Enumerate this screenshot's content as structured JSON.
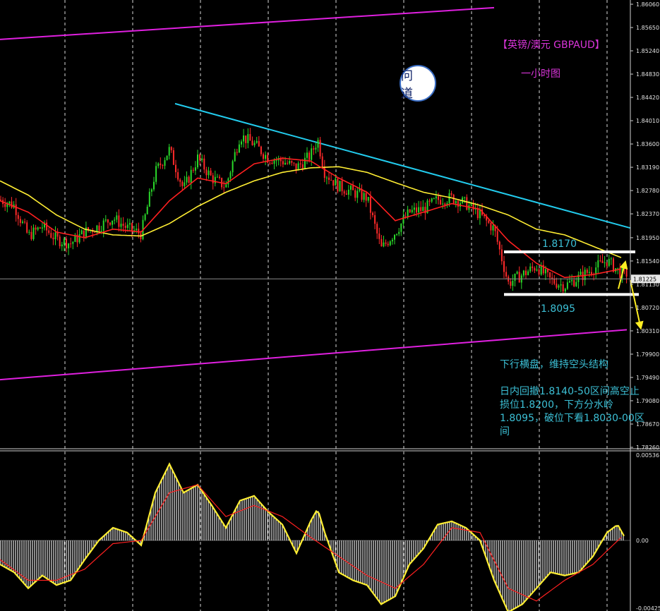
{
  "annotations": {
    "title": "【英镑/澳元 GBPAUD】",
    "timeframe": "一小时图",
    "logo_text": "问 道",
    "level_high": "1.8170",
    "level_low": "1.8095",
    "note1": "下行横盘，维持空头结构",
    "note2": "日内回撤1.8140-50区间高空止损位1.8200，下方分水岭1.8095，破位下看1.8030-00区间"
  },
  "chart_data": [
    {
      "type": "candlestick",
      "title": "",
      "price_axis": {
        "ylim": [
          1.7826,
          1.8606
        ],
        "tick_labels": [
          "1.86060",
          "1.85650",
          "1.85240",
          "1.84830",
          "1.84420",
          "1.84010",
          "1.83600",
          "1.83190",
          "1.82780",
          "1.82370",
          "1.81950",
          "1.81540",
          "1.81130",
          "1.80720",
          "1.80310",
          "1.79900",
          "1.79490",
          "1.79080",
          "1.78670",
          "1.78260"
        ],
        "current_price": "1.81225"
      },
      "price_path": [
        [
          0,
          1.8262
        ],
        [
          20,
          1.8252
        ],
        [
          40,
          1.8198
        ],
        [
          60,
          1.8215
        ],
        [
          80,
          1.8192
        ],
        [
          100,
          1.8185
        ],
        [
          120,
          1.8205
        ],
        [
          140,
          1.8215
        ],
        [
          160,
          1.823
        ],
        [
          180,
          1.8212
        ],
        [
          200,
          1.8202
        ],
        [
          220,
          1.831
        ],
        [
          240,
          1.835
        ],
        [
          260,
          1.828
        ],
        [
          280,
          1.8335
        ],
        [
          300,
          1.83
        ],
        [
          320,
          1.8285
        ],
        [
          340,
          1.8375
        ],
        [
          360,
          1.836
        ],
        [
          380,
          1.8335
        ],
        [
          400,
          1.833
        ],
        [
          420,
          1.8318
        ],
        [
          440,
          1.834
        ],
        [
          450,
          1.8368
        ],
        [
          460,
          1.831
        ],
        [
          480,
          1.8285
        ],
        [
          500,
          1.8275
        ],
        [
          520,
          1.8265
        ],
        [
          540,
          1.8175
        ],
        [
          560,
          1.8205
        ],
        [
          580,
          1.824
        ],
        [
          600,
          1.8245
        ],
        [
          620,
          1.8262
        ],
        [
          640,
          1.8265
        ],
        [
          660,
          1.8255
        ],
        [
          680,
          1.8235
        ],
        [
          700,
          1.821
        ],
        [
          720,
          1.8115
        ],
        [
          740,
          1.813
        ],
        [
          760,
          1.8145
        ],
        [
          780,
          1.812
        ],
        [
          800,
          1.811
        ],
        [
          820,
          1.8125
        ],
        [
          840,
          1.814
        ],
        [
          860,
          1.8155
        ],
        [
          880,
          1.8132
        ]
      ],
      "ma_fast": [
        [
          0,
          1.826
        ],
        [
          40,
          1.824
        ],
        [
          80,
          1.8205
        ],
        [
          120,
          1.8195
        ],
        [
          160,
          1.821
        ],
        [
          200,
          1.8205
        ],
        [
          240,
          1.826
        ],
        [
          280,
          1.83
        ],
        [
          320,
          1.829
        ],
        [
          360,
          1.8325
        ],
        [
          400,
          1.8335
        ],
        [
          440,
          1.833
        ],
        [
          480,
          1.83
        ],
        [
          520,
          1.8275
        ],
        [
          560,
          1.8225
        ],
        [
          600,
          1.824
        ],
        [
          640,
          1.8255
        ],
        [
          680,
          1.8245
        ],
        [
          720,
          1.819
        ],
        [
          760,
          1.815
        ],
        [
          800,
          1.8125
        ],
        [
          840,
          1.813
        ],
        [
          880,
          1.814
        ]
      ],
      "ma_slow": [
        [
          0,
          1.8295
        ],
        [
          40,
          1.827
        ],
        [
          80,
          1.8235
        ],
        [
          120,
          1.821
        ],
        [
          160,
          1.82
        ],
        [
          200,
          1.8198
        ],
        [
          240,
          1.822
        ],
        [
          280,
          1.825
        ],
        [
          320,
          1.8275
        ],
        [
          360,
          1.8295
        ],
        [
          400,
          1.831
        ],
        [
          440,
          1.8318
        ],
        [
          480,
          1.832
        ],
        [
          520,
          1.831
        ],
        [
          560,
          1.8292
        ],
        [
          600,
          1.8275
        ],
        [
          640,
          1.8265
        ],
        [
          680,
          1.8252
        ],
        [
          720,
          1.8235
        ],
        [
          760,
          1.821
        ],
        [
          800,
          1.82
        ],
        [
          840,
          1.818
        ],
        [
          880,
          1.816
        ]
      ],
      "trendlines": [
        {
          "color": "#e020e0",
          "points": [
            [
              0,
              1.8544
            ],
            [
              700,
              1.86
            ]
          ]
        },
        {
          "color": "#e020e0",
          "points": [
            [
              0,
              1.7945
            ],
            [
              888,
              1.8033
            ]
          ]
        },
        {
          "color": "#22ccee",
          "points": [
            [
              248,
              1.8431
            ],
            [
              893,
              1.8212
            ]
          ]
        }
      ],
      "levels": [
        {
          "value": 1.817,
          "x": [
            714,
            900
          ]
        },
        {
          "value": 1.8095,
          "x": [
            714,
            905
          ]
        }
      ]
    },
    {
      "type": "histogram",
      "title": "",
      "y_axis": {
        "tick_labels": [
          "0.00536",
          "0.00",
          "-0.00425"
        ],
        "ylim": [
          -0.00425,
          0.00536
        ]
      },
      "macd": [
        [
          0,
          -0.0015
        ],
        [
          20,
          -0.002
        ],
        [
          40,
          -0.003
        ],
        [
          60,
          -0.0022
        ],
        [
          80,
          -0.0028
        ],
        [
          100,
          -0.0025
        ],
        [
          120,
          -0.0012
        ],
        [
          140,
          0.0
        ],
        [
          160,
          0.0008
        ],
        [
          180,
          0.0005
        ],
        [
          200,
          -0.0003
        ],
        [
          220,
          0.003
        ],
        [
          240,
          0.0048
        ],
        [
          260,
          0.003
        ],
        [
          280,
          0.0035
        ],
        [
          300,
          0.0022
        ],
        [
          320,
          0.0008
        ],
        [
          340,
          0.0025
        ],
        [
          360,
          0.0028
        ],
        [
          380,
          0.0018
        ],
        [
          400,
          0.001
        ],
        [
          420,
          -0.0008
        ],
        [
          440,
          0.0012
        ],
        [
          450,
          0.002
        ],
        [
          460,
          0.0005
        ],
        [
          480,
          -0.002
        ],
        [
          500,
          -0.0025
        ],
        [
          520,
          -0.0028
        ],
        [
          540,
          -0.004
        ],
        [
          560,
          -0.0035
        ],
        [
          580,
          -0.0015
        ],
        [
          600,
          -0.0005
        ],
        [
          620,
          0.001
        ],
        [
          640,
          0.0012
        ],
        [
          660,
          0.0008
        ],
        [
          680,
          0.0
        ],
        [
          700,
          -0.0025
        ],
        [
          720,
          -0.0045
        ],
        [
          740,
          -0.004
        ],
        [
          760,
          -0.003
        ],
        [
          780,
          -0.002
        ],
        [
          800,
          -0.0022
        ],
        [
          820,
          -0.002
        ],
        [
          840,
          -0.001
        ],
        [
          860,
          0.0005
        ],
        [
          875,
          0.001
        ],
        [
          885,
          0.0002
        ]
      ],
      "signal": [
        [
          0,
          -0.0012
        ],
        [
          40,
          -0.0025
        ],
        [
          80,
          -0.0025
        ],
        [
          120,
          -0.0018
        ],
        [
          160,
          -0.0002
        ],
        [
          200,
          0.0
        ],
        [
          240,
          0.003
        ],
        [
          280,
          0.0035
        ],
        [
          320,
          0.0015
        ],
        [
          360,
          0.0022
        ],
        [
          400,
          0.0015
        ],
        [
          440,
          0.0002
        ],
        [
          480,
          -0.001
        ],
        [
          520,
          -0.0022
        ],
        [
          560,
          -0.003
        ],
        [
          600,
          -0.0015
        ],
        [
          640,
          0.0008
        ],
        [
          680,
          0.0005
        ],
        [
          720,
          -0.003
        ],
        [
          760,
          -0.0038
        ],
        [
          800,
          -0.0025
        ],
        [
          840,
          -0.0015
        ],
        [
          880,
          0.0002
        ]
      ]
    }
  ]
}
